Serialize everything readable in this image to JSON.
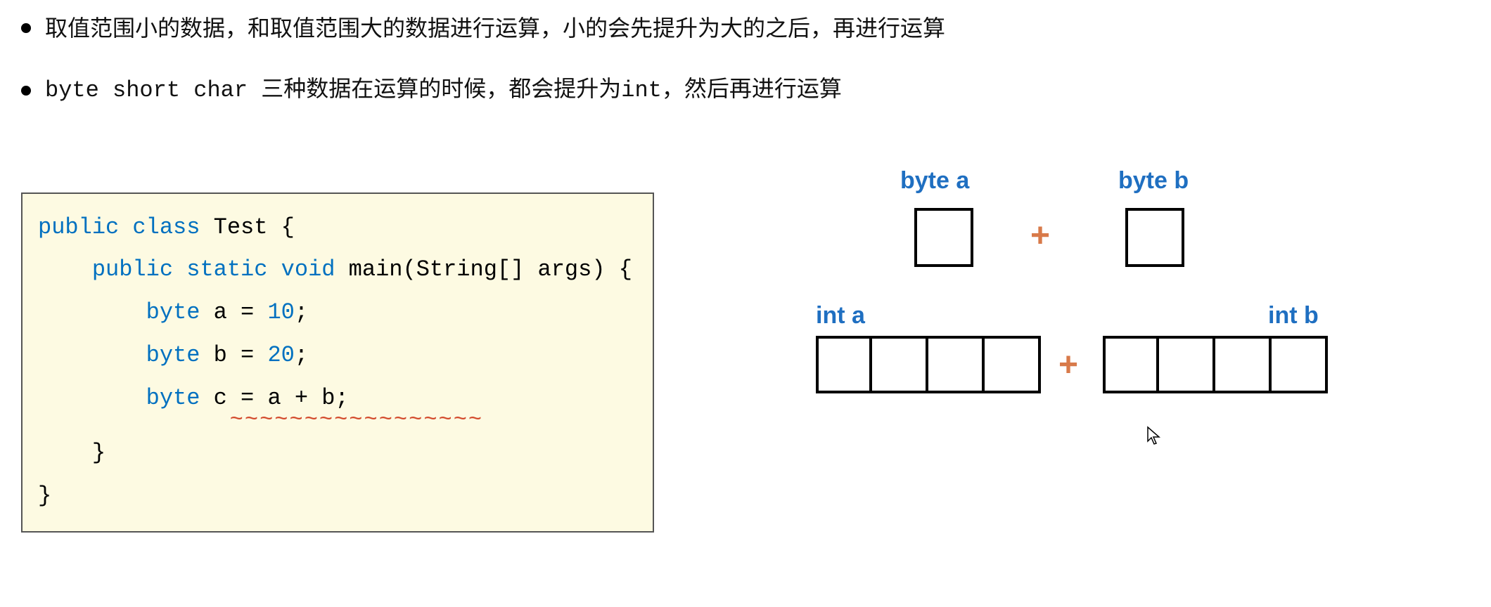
{
  "bullets": [
    "取值范围小的数据，和取值范围大的数据进行运算，小的会先提升为大的之后，再进行运算",
    "byte short char 三种数据在运算的时候，都会提升为int，然后再进行运算"
  ],
  "code": {
    "tk_public": "public",
    "tk_class": "class",
    "tk_Test": "Test",
    "tk_obrace": "{",
    "tk_static": "static",
    "tk_void": "void",
    "tk_main": "main",
    "tk_sig": "(String[] args) {",
    "tk_byte": "byte",
    "a_decl": "a = ",
    "a_val": "10",
    "b_decl": "b = ",
    "b_val": "20",
    "c_decl": "c = a + b",
    "semi": ";",
    "cbrace": "}",
    "wavy": "~~~~~~~~~~~~~~~~~"
  },
  "diagram": {
    "byte_a": "byte a",
    "byte_b": "byte b",
    "int_a": "int a",
    "int_b": "int b",
    "plus": "+"
  }
}
